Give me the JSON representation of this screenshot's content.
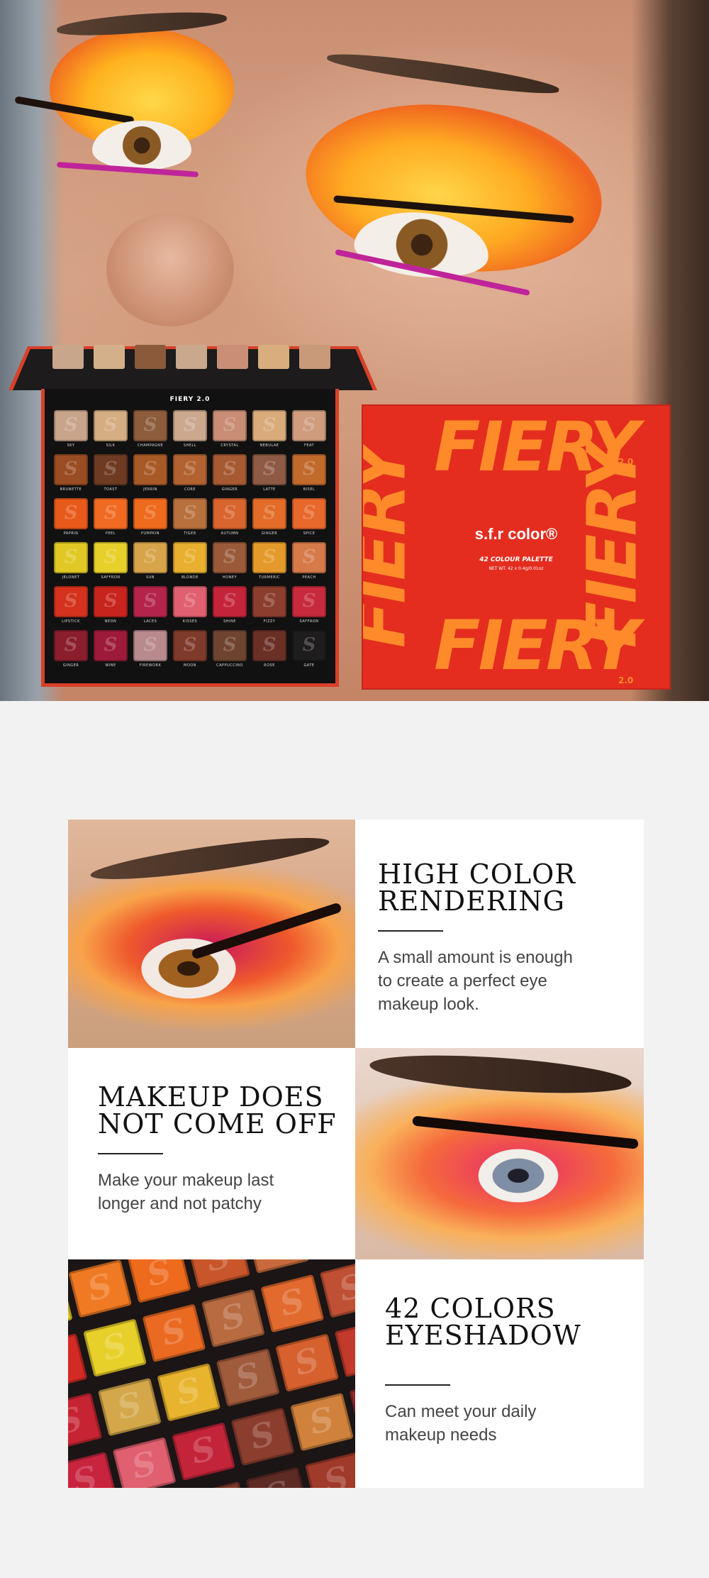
{
  "hero": {
    "palette_name": "FIERY 2.0",
    "mirror_swatches": [
      "#c7a68b",
      "#d4b08a",
      "#8a5a3a",
      "#c9a88d",
      "#c98f76",
      "#d9ad7e",
      "#c99a7a"
    ],
    "palette_rows": [
      [
        {
          "name": "SKY",
          "color": "#c8a48a"
        },
        {
          "name": "SILK",
          "color": "#d5ad82"
        },
        {
          "name": "CHAMPAGNE",
          "color": "#8c5c3c"
        },
        {
          "name": "SHELL",
          "color": "#cba88e"
        },
        {
          "name": "CRYSTAL",
          "color": "#c88d74"
        },
        {
          "name": "NEBULAE",
          "color": "#d9ab7b"
        },
        {
          "name": "FEAT",
          "color": "#cf9c7e"
        }
      ],
      [
        {
          "name": "BRUNETTE",
          "color": "#9a4c22"
        },
        {
          "name": "TOAST",
          "color": "#6e3a22"
        },
        {
          "name": "JERRIN",
          "color": "#a85a26"
        },
        {
          "name": "CORE",
          "color": "#b26230"
        },
        {
          "name": "GINGER",
          "color": "#a65a32"
        },
        {
          "name": "LATTE",
          "color": "#8e5a44"
        },
        {
          "name": "BISEL",
          "color": "#c06a2c"
        }
      ],
      [
        {
          "name": "PAPRIN",
          "color": "#e85a1a"
        },
        {
          "name": "PEEL",
          "color": "#f06a22"
        },
        {
          "name": "PUMPKIN",
          "color": "#ee6a1c"
        },
        {
          "name": "TIGER",
          "color": "#b8703c"
        },
        {
          "name": "AUTUMN",
          "color": "#d8642e"
        },
        {
          "name": "GINGER",
          "color": "#e26c28"
        },
        {
          "name": "SPICE",
          "color": "#e8682c"
        }
      ],
      [
        {
          "name": "JELONET",
          "color": "#e2c824"
        },
        {
          "name": "SAFFRON",
          "color": "#e8d02a"
        },
        {
          "name": "SUN",
          "color": "#d8a44a"
        },
        {
          "name": "BLONDE",
          "color": "#e8b02e"
        },
        {
          "name": "HONEY",
          "color": "#9a5a3a"
        },
        {
          "name": "TURMERIC",
          "color": "#e49a2a"
        },
        {
          "name": "PEACH",
          "color": "#d67a4a"
        }
      ],
      [
        {
          "name": "LIPSTICK",
          "color": "#d4321c"
        },
        {
          "name": "NEON",
          "color": "#c8241e"
        },
        {
          "name": "LACES",
          "color": "#b4244a"
        },
        {
          "name": "KISSES",
          "color": "#e06070"
        },
        {
          "name": "SHINE",
          "color": "#c4243a"
        },
        {
          "name": "FIZZY",
          "color": "#8c3e2e"
        },
        {
          "name": "SAFFRON",
          "color": "#c62a3c"
        }
      ],
      [
        {
          "name": "GINGER",
          "color": "#8a1e2c"
        },
        {
          "name": "WINE",
          "color": "#9e1a3a"
        },
        {
          "name": "FIREWORK",
          "color": "#b88a8e"
        },
        {
          "name": "MOON",
          "color": "#7e3a2a"
        },
        {
          "name": "CAPPUCCINO",
          "color": "#6e4430"
        },
        {
          "name": "ROSE",
          "color": "#6a3026"
        },
        {
          "name": "GATE",
          "color": "#1e1c1c"
        }
      ]
    ],
    "box": {
      "word": "FIERY",
      "version": "2.0",
      "brand": "s.f.r color®",
      "subtitle": "42 COLOUR PALETTE",
      "net_wt": "NET WT. 42 x 0.4g/0.01oz"
    }
  },
  "features": [
    {
      "title_line1": "HIGH COLOR",
      "title_line2": "RENDERING",
      "desc_line1": "A small amount is enough",
      "desc_line2": "to create a perfect eye",
      "desc_line3": "makeup look."
    },
    {
      "title_line1": "MAKEUP DOES",
      "title_line2": "NOT COME OFF",
      "desc_line1": "Make your makeup last",
      "desc_line2": "longer and not patchy",
      "desc_line3": ""
    },
    {
      "title_line1": "42 COLORS",
      "title_line2": "EYESHADOW",
      "desc_line1": "Can meet your daily",
      "desc_line2": "makeup needs",
      "desc_line3": ""
    }
  ],
  "closeup_swatches": [
    "#e8d22c",
    "#f07a24",
    "#ee6a1c",
    "#c8562a",
    "#c86a3c",
    "#d87a4a",
    "#d42a24",
    "#e8d02a",
    "#ea6a22",
    "#b86a40",
    "#e26a2e",
    "#c05034",
    "#c62432",
    "#d4a84a",
    "#e8b42e",
    "#a05a3c",
    "#d6602e",
    "#c23a2c",
    "#c8243e",
    "#e06070",
    "#c4243a",
    "#8c3e2e",
    "#d0823c",
    "#9a2a30",
    "#b08088",
    "#cc3a52",
    "#7e3a2a",
    "#5e2a24",
    "#a03a2a",
    "#6a2420"
  ]
}
